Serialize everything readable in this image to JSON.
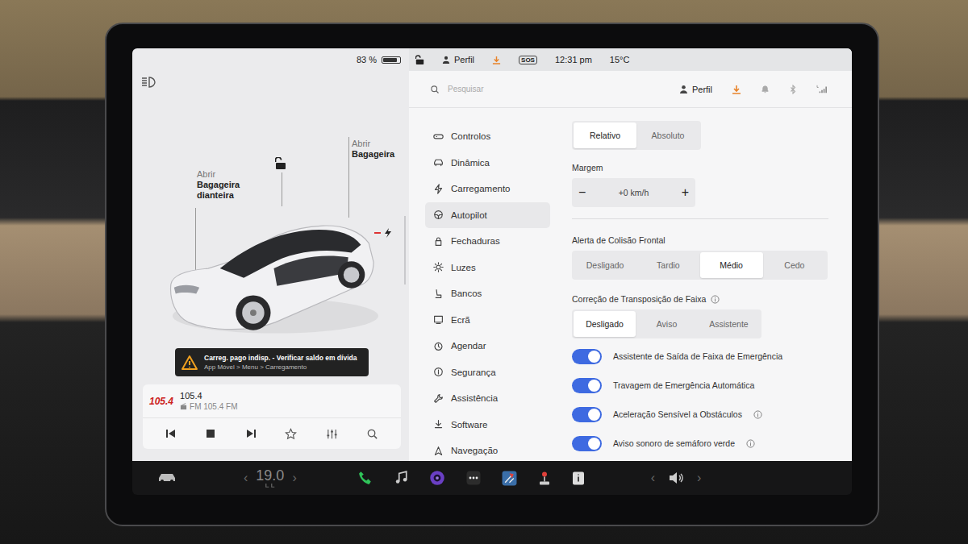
{
  "status_bar": {
    "battery": "83 %",
    "battery_level": 0.83,
    "locked": false,
    "profile": "Perfil",
    "sos": "SOS",
    "time": "12:31 pm",
    "temperature": "15°C"
  },
  "car_panel": {
    "front_trunk": {
      "verb": "Abrir",
      "object": "Bagageira dianteira"
    },
    "rear_trunk": {
      "verb": "Abrir",
      "object": "Bagageira"
    },
    "door_lock": {
      "locked": false
    },
    "warning": {
      "title": "Carreg. pago indisp. - Verificar saldo em dívida",
      "path": "App Móvel > Menu > Carregamento"
    },
    "media": {
      "logo": "105.4",
      "title": "105.4",
      "subtitle": "FM 105.4 FM",
      "playing": true
    }
  },
  "header": {
    "search_placeholder": "Pesquisar",
    "profile": "Perfil"
  },
  "menu": {
    "items": [
      {
        "label": "Controlos",
        "selected": false
      },
      {
        "label": "Dinâmica",
        "selected": false
      },
      {
        "label": "Carregamento",
        "selected": false
      },
      {
        "label": "Autopilot",
        "selected": true
      },
      {
        "label": "Fechaduras",
        "selected": false
      },
      {
        "label": "Luzes",
        "selected": false
      },
      {
        "label": "Bancos",
        "selected": false
      },
      {
        "label": "Ecrã",
        "selected": false
      },
      {
        "label": "Agendar",
        "selected": false
      },
      {
        "label": "Segurança",
        "selected": false
      },
      {
        "label": "Assistência",
        "selected": false
      },
      {
        "label": "Software",
        "selected": false
      },
      {
        "label": "Navegação",
        "selected": false
      }
    ]
  },
  "settings": {
    "speed_mode": {
      "options": [
        {
          "label": "Relativo",
          "selected": true
        },
        {
          "label": "Absoluto",
          "selected": false
        }
      ]
    },
    "offset": {
      "label": "Margem",
      "decrement": "−",
      "value": "+0 km/h",
      "increment": "+"
    },
    "collision_warning": {
      "label": "Alerta de Colisão Frontal",
      "info": false,
      "options": [
        {
          "label": "Desligado",
          "selected": false
        },
        {
          "label": "Tardio",
          "selected": false
        },
        {
          "label": "Médio",
          "selected": true
        },
        {
          "label": "Cedo",
          "selected": false
        }
      ]
    },
    "lane_departure": {
      "label": "Correção de Transposição de Faixa",
      "info": true,
      "options": [
        {
          "label": "Desligado",
          "selected": true
        },
        {
          "label": "Aviso",
          "selected": false
        },
        {
          "label": "Assistente",
          "selected": false
        }
      ]
    },
    "toggles": [
      {
        "label": "Assistente de Saída de Faixa de Emergência",
        "on": true,
        "info": false
      },
      {
        "label": "Travagem de Emergência Automática",
        "on": true,
        "info": false
      },
      {
        "label": "Aceleração Sensível a Obstáculos",
        "on": true,
        "info": true
      },
      {
        "label": "Aviso sonoro de semáforo verde",
        "on": true,
        "info": true
      }
    ]
  },
  "taskbar": {
    "climate": {
      "left_arrow": "‹",
      "temperature": "19.0",
      "right_arrow": "›"
    },
    "volume": {
      "left_arrow": "‹",
      "right_arrow": "›"
    }
  }
}
